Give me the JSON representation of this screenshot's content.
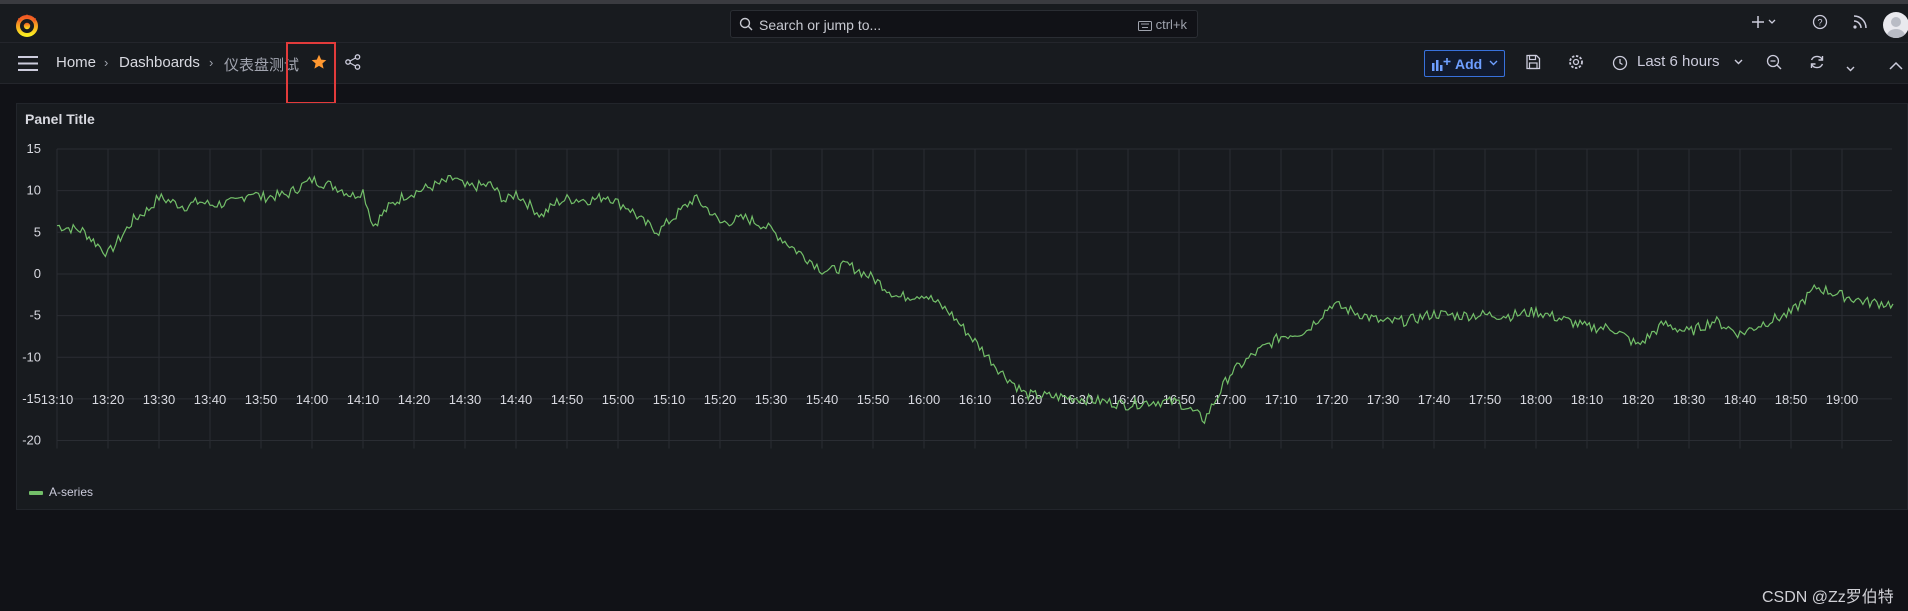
{
  "topbar": {
    "search_placeholder": "Search or jump to...",
    "search_shortcut": "ctrl+k",
    "icons": [
      "grafana-logo-icon",
      "search-icon",
      "keyboard-icon",
      "plus-icon",
      "help-icon",
      "news-icon",
      "user-avatar"
    ]
  },
  "navbar": {
    "breadcrumbs": [
      "Home",
      "Dashboards",
      "仪表盘测试"
    ],
    "add_label": "Add",
    "time_range": "Last 6 hours",
    "icons": [
      "menu-icon",
      "star-icon",
      "share-icon",
      "add-panel-icon",
      "save-icon",
      "settings-icon",
      "clock-icon",
      "zoom-out-icon",
      "refresh-icon",
      "collapse-icon"
    ]
  },
  "colors": {
    "background": "#111217",
    "panel": "#181b1f",
    "series": "#73bf69",
    "accent": "#3871dc",
    "star": "#ff9830",
    "highlight_box": "#e23b3b"
  },
  "panel": {
    "title": "Panel Title"
  },
  "chart_data": {
    "type": "line",
    "title": "Panel Title",
    "xlabel": "",
    "ylabel": "",
    "ylim": [
      -22,
      15
    ],
    "yticks": [
      15,
      10,
      5,
      0,
      -5,
      -10,
      -15,
      -20
    ],
    "xticks": [
      "13:10",
      "13:20",
      "13:30",
      "13:40",
      "13:50",
      "14:00",
      "14:10",
      "14:20",
      "14:30",
      "14:40",
      "14:50",
      "15:00",
      "15:10",
      "15:20",
      "15:30",
      "15:40",
      "15:50",
      "16:00",
      "16:10",
      "16:20",
      "16:30",
      "16:40",
      "16:50",
      "17:00",
      "17:10",
      "17:20",
      "17:30",
      "17:40",
      "17:50",
      "18:00",
      "18:10",
      "18:20",
      "18:30",
      "18:40",
      "18:50",
      "19:00"
    ],
    "grid": true,
    "legend_position": "bottom-left",
    "series": [
      {
        "name": "A-series",
        "x_minutes_from_1310": [
          0,
          5,
          8,
          10,
          12,
          15,
          18,
          20,
          25,
          28,
          30,
          35,
          38,
          40,
          45,
          48,
          50,
          55,
          58,
          60,
          62,
          65,
          68,
          70,
          75,
          78,
          80,
          85,
          88,
          90,
          95,
          98,
          100,
          105,
          108,
          110,
          112,
          115,
          118,
          120,
          125,
          128,
          130,
          135,
          138,
          140,
          145,
          148,
          150,
          152,
          155,
          160,
          165,
          170,
          175,
          180,
          185,
          190,
          195,
          200,
          205,
          210,
          215,
          220,
          225,
          230,
          235,
          240,
          245,
          250,
          255,
          260,
          265,
          270,
          275,
          280,
          285,
          290,
          295,
          300,
          305,
          310,
          315,
          320,
          325,
          330,
          335,
          340,
          345,
          350,
          355,
          360
        ],
        "values": [
          5.8,
          5.2,
          3.5,
          2.4,
          4.0,
          6.5,
          7.8,
          9.2,
          8.1,
          8.7,
          8.3,
          8.6,
          9.9,
          9.2,
          9.5,
          10.6,
          11.3,
          10.4,
          9.4,
          10.0,
          5.8,
          8.0,
          9.4,
          9.8,
          10.8,
          11.5,
          10.4,
          10.7,
          8.7,
          9.7,
          7.0,
          8.6,
          9.0,
          8.9,
          9.4,
          8.5,
          8.0,
          6.2,
          5.1,
          6.3,
          9.1,
          7.6,
          6.1,
          6.7,
          6.0,
          5.3,
          2.8,
          1.5,
          0.5,
          0.4,
          1.1,
          -0.5,
          -2.8,
          -2.4,
          -4.6,
          -8.1,
          -11.7,
          -14.5,
          -14.7,
          -14.9,
          -15.3,
          -15.7,
          -15.3,
          -15.4,
          -17.5,
          -12.0,
          -9.5,
          -7.5,
          -6.8,
          -3.6,
          -4.7,
          -5.8,
          -5.6,
          -4.8,
          -5.0,
          -4.9,
          -5.0,
          -4.5,
          -5.4,
          -6.4,
          -6.5,
          -8.6,
          -6.0,
          -7.0,
          -5.6,
          -7.2,
          -5.8,
          -4.7,
          -1.6,
          -2.6,
          -3.4,
          -3.6
        ]
      }
    ]
  },
  "watermark": "CSDN @Zz罗伯特"
}
